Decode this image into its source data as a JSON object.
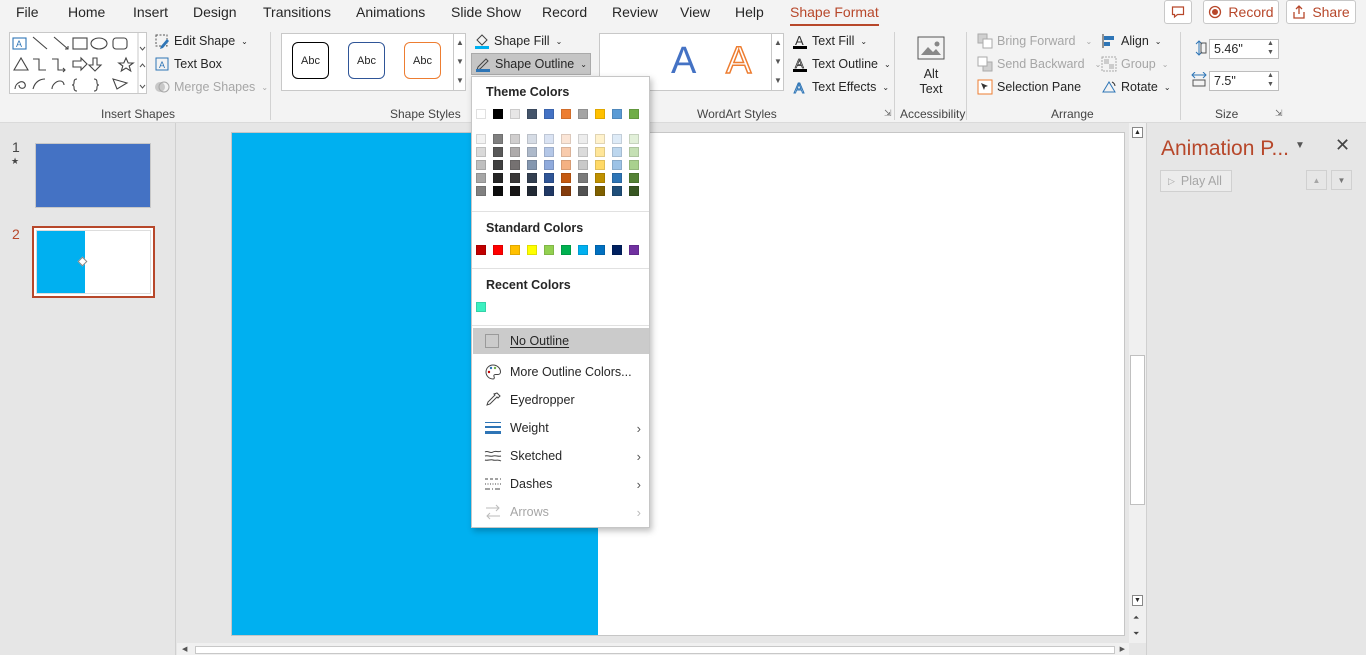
{
  "tabs": [
    "File",
    "Home",
    "Insert",
    "Design",
    "Transitions",
    "Animations",
    "Slide Show",
    "Record",
    "Review",
    "View",
    "Help",
    "Shape Format"
  ],
  "top_buttons": {
    "record": "Record",
    "share": "Share"
  },
  "ribbon": {
    "insert_shapes": {
      "label": "Insert Shapes",
      "edit_shape": "Edit Shape",
      "text_box": "Text Box",
      "merge_shapes": "Merge Shapes"
    },
    "shape_styles": {
      "label": "Shape Styles",
      "preset": "Abc",
      "shape_fill": "Shape Fill",
      "shape_outline": "Shape Outline"
    },
    "wordart": {
      "label": "WordArt Styles",
      "letter": "A",
      "text_fill": "Text Fill",
      "text_outline": "Text Outline",
      "text_effects": "Text Effects"
    },
    "accessibility": {
      "label": "Accessibility",
      "alt_text": "Alt\nText"
    },
    "arrange": {
      "label": "Arrange",
      "bring_forward": "Bring Forward",
      "send_backward": "Send Backward",
      "selection_pane": "Selection Pane",
      "align": "Align",
      "group": "Group",
      "rotate": "Rotate"
    },
    "size": {
      "label": "Size",
      "height": "5.46\"",
      "width": "7.5\""
    }
  },
  "slides": [
    {
      "number": "1",
      "star": "★"
    },
    {
      "number": "2"
    }
  ],
  "animation_pane": {
    "title": "Animation P...",
    "play_all": "Play All"
  },
  "outline_menu": {
    "theme_colors_label": "Theme Colors",
    "theme_top": [
      "#ffffff",
      "#000000",
      "#e7e6e6",
      "#44546a",
      "#4472c4",
      "#ed7d31",
      "#a5a5a5",
      "#ffc000",
      "#5b9bd5",
      "#70ad47"
    ],
    "theme_shades": [
      [
        "#f2f2f2",
        "#d9d9d9",
        "#bfbfbf",
        "#a6a6a6",
        "#808080"
      ],
      [
        "#808080",
        "#595959",
        "#404040",
        "#262626",
        "#0d0d0d"
      ],
      [
        "#d0cece",
        "#aeabab",
        "#757171",
        "#3a3838",
        "#171616"
      ],
      [
        "#d6dce5",
        "#adb9ca",
        "#8497b0",
        "#333f50",
        "#222a35"
      ],
      [
        "#dae3f3",
        "#b4c7e7",
        "#8faadc",
        "#2f5597",
        "#203864"
      ],
      [
        "#fbe5d6",
        "#f8cbad",
        "#f4b183",
        "#c55a11",
        "#843c0c"
      ],
      [
        "#ededed",
        "#dbdbdb",
        "#c9c9c9",
        "#7b7b7b",
        "#525252"
      ],
      [
        "#fff2cc",
        "#ffe699",
        "#ffd966",
        "#bf9000",
        "#7f6000"
      ],
      [
        "#deebf7",
        "#bdd7ee",
        "#9dc3e6",
        "#2e75b6",
        "#1f4e79"
      ],
      [
        "#e2f0d9",
        "#c5e0b4",
        "#a9d18e",
        "#548235",
        "#385723"
      ]
    ],
    "standard_colors_label": "Standard Colors",
    "standard": [
      "#c00000",
      "#ff0000",
      "#ffc000",
      "#ffff00",
      "#92d050",
      "#00b050",
      "#00b0f0",
      "#0070c0",
      "#002060",
      "#7030a0"
    ],
    "recent_colors_label": "Recent Colors",
    "recent": [
      "#3cf0c0"
    ],
    "items": [
      {
        "label": "No Outline",
        "icon": "no-outline-icon",
        "arrow": false
      },
      {
        "label": "More Outline Colors...",
        "icon": "palette-icon",
        "arrow": false
      },
      {
        "label": "Eyedropper",
        "icon": "eyedropper-icon",
        "arrow": false
      },
      {
        "label": "Weight",
        "icon": "weight-icon",
        "arrow": true
      },
      {
        "label": "Sketched",
        "icon": "sketched-icon",
        "arrow": true
      },
      {
        "label": "Dashes",
        "icon": "dashes-icon",
        "arrow": true
      },
      {
        "label": "Arrows",
        "icon": "arrows-icon",
        "arrow": true
      }
    ]
  },
  "colors": {
    "accent": "#b7472a",
    "shape_fill": "#00b0f0",
    "slide1_fill": "#4472c4"
  }
}
